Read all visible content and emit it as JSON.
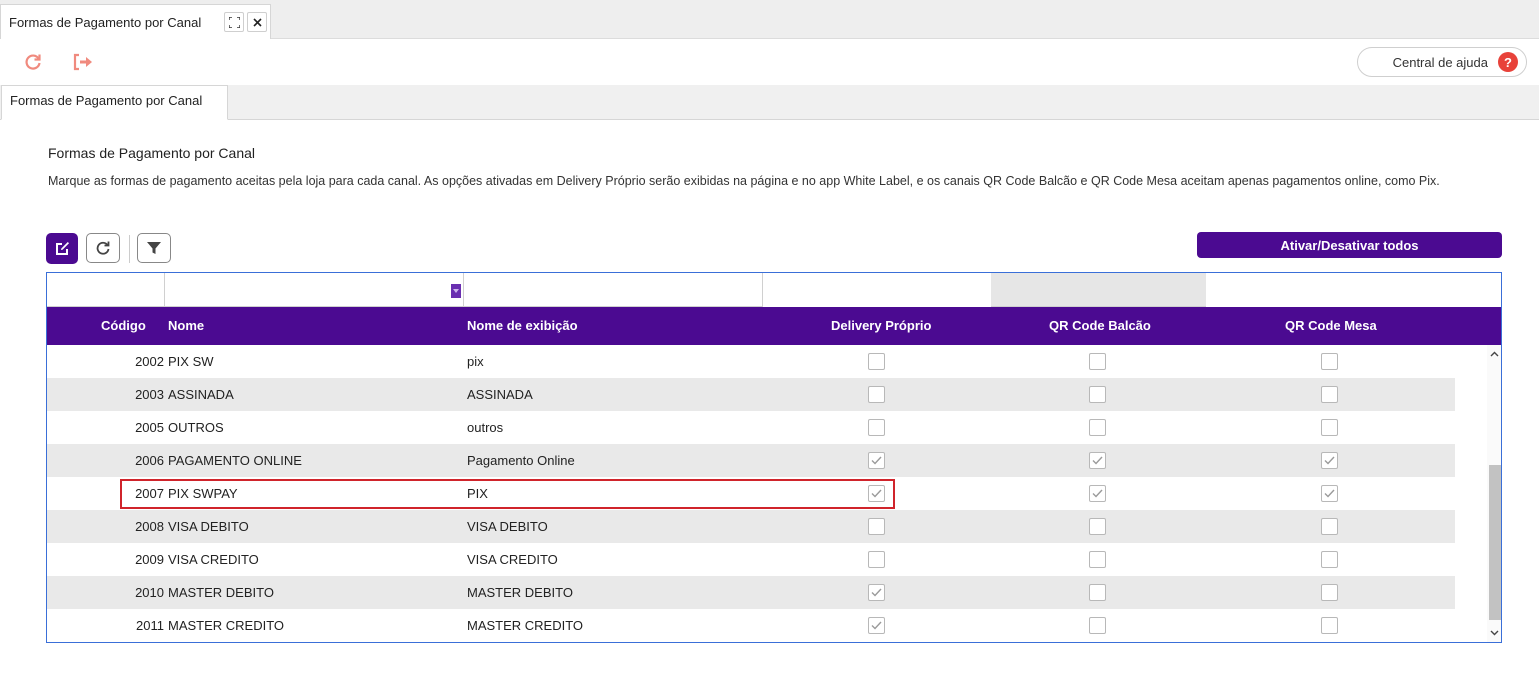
{
  "window_tab": {
    "label": "Formas de Pagamento por Canal"
  },
  "toolbar": {
    "help_label": "Central de ajuda",
    "help_symbol": "?"
  },
  "subtab": {
    "label": "Formas de Pagamento por Canal"
  },
  "section": {
    "title": "Formas de Pagamento por Canal",
    "description": "Marque as formas de pagamento aceitas pela loja para cada canal. As opções ativadas em Delivery Próprio serão exibidas na página e no app White Label, e os canais QR Code Balcão e QR Code Mesa aceitam apenas pagamentos online, como Pix."
  },
  "actions": {
    "toggle_all_label": "Ativar/Desativar todos"
  },
  "table": {
    "columns": [
      "Código",
      "Nome",
      "Nome de exibição",
      "Delivery Próprio",
      "QR Code Balcão",
      "QR Code Mesa"
    ],
    "rows": [
      {
        "code": "2002",
        "name": "PIX SW",
        "display": "pix",
        "delivery": false,
        "balcao": false,
        "mesa": false
      },
      {
        "code": "2003",
        "name": "ASSINADA",
        "display": "ASSINADA",
        "delivery": false,
        "balcao": false,
        "mesa": false
      },
      {
        "code": "2005",
        "name": "OUTROS",
        "display": "outros",
        "delivery": false,
        "balcao": false,
        "mesa": false
      },
      {
        "code": "2006",
        "name": "PAGAMENTO ONLINE",
        "display": "Pagamento Online",
        "delivery": true,
        "balcao": true,
        "mesa": true
      },
      {
        "code": "2007",
        "name": "PIX SWPAY",
        "display": "PIX",
        "delivery": true,
        "balcao": true,
        "mesa": true
      },
      {
        "code": "2008",
        "name": "VISA DEBITO",
        "display": "VISA DEBITO",
        "delivery": false,
        "balcao": false,
        "mesa": false
      },
      {
        "code": "2009",
        "name": "VISA CREDITO",
        "display": "VISA CREDITO",
        "delivery": false,
        "balcao": false,
        "mesa": false
      },
      {
        "code": "2010",
        "name": "MASTER DEBITO",
        "display": "MASTER DEBITO",
        "delivery": true,
        "balcao": false,
        "mesa": false
      },
      {
        "code": "2011",
        "name": "MASTER CREDITO",
        "display": "MASTER CREDITO",
        "delivery": true,
        "balcao": false,
        "mesa": false
      }
    ]
  },
  "colors": {
    "primary": "#4b0a91",
    "accent_icon": "#f08a7e",
    "help_badge": "#e8423a",
    "highlight": "#d0242b",
    "row_alt": "#e9e9e9"
  }
}
